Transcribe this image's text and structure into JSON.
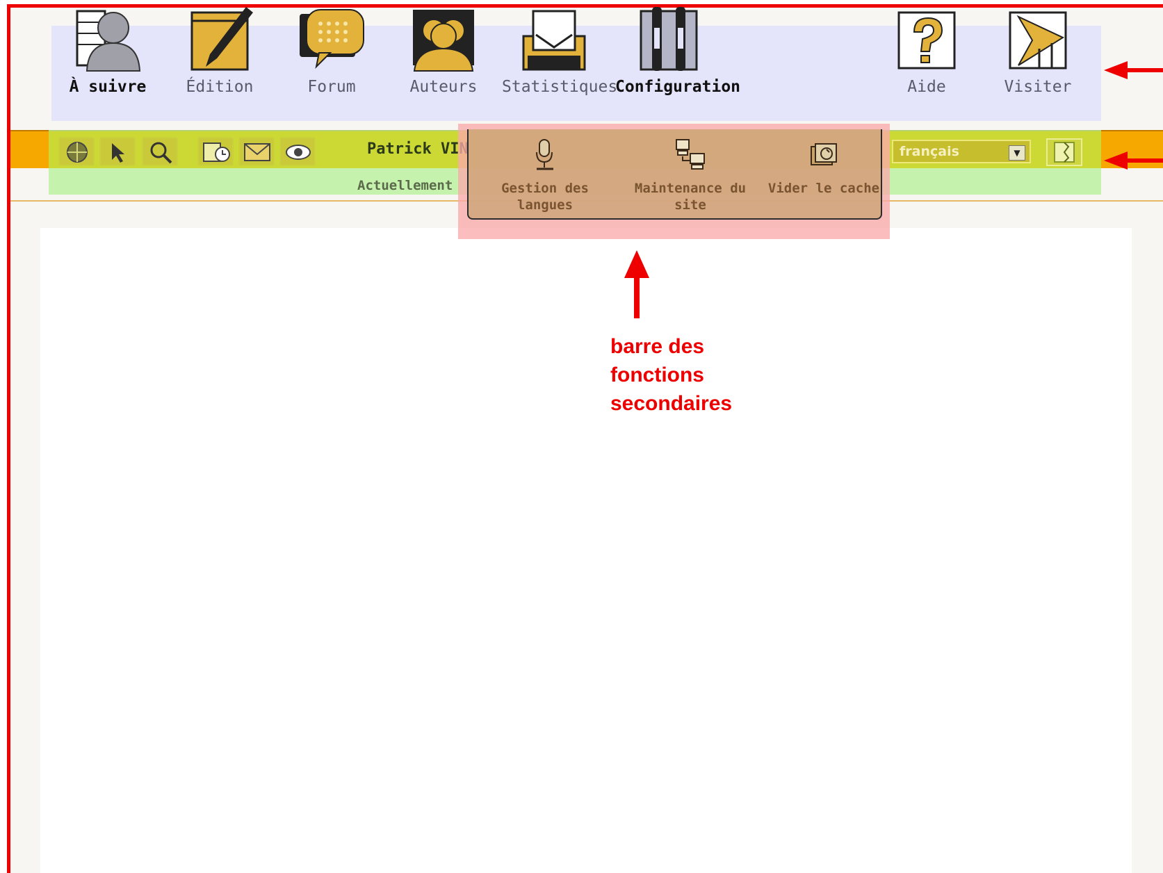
{
  "main_toolbar": {
    "items": [
      {
        "label": "À suivre",
        "icon": "user-follow-icon",
        "active": true
      },
      {
        "label": "Édition",
        "icon": "pen-edit-icon"
      },
      {
        "label": "Forum",
        "icon": "speech-bubble-icon"
      },
      {
        "label": "Auteurs",
        "icon": "authors-group-icon"
      },
      {
        "label": "Statistiques",
        "icon": "statistics-icon"
      },
      {
        "label": "Configuration",
        "icon": "tools-config-icon"
      },
      {
        "label": "Aide",
        "icon": "help-icon"
      },
      {
        "label": "Visiter",
        "icon": "visit-site-icon"
      }
    ]
  },
  "secondary_bar": {
    "user_name": "Patrick VIN",
    "status_text": "Actuellement",
    "language_value": "français",
    "mini_icons": [
      "globe-icon",
      "cursor-icon",
      "search-zoom-icon",
      "calendar-clock-icon",
      "mail-icon",
      "eye-icon"
    ]
  },
  "sub_menu": {
    "items": [
      {
        "label_line1": "Gestion des",
        "label_line2": "langues",
        "icon": "microphone-icon"
      },
      {
        "label_line1": "Maintenance du",
        "label_line2": "site",
        "icon": "computers-network-icon"
      },
      {
        "label_line1": "Vider le cache",
        "label_line2": "",
        "icon": "cache-folder-icon"
      }
    ]
  },
  "annotation": {
    "line1": "barre des",
    "line2": "fonctions",
    "line3": "secondaires",
    "color": "#ee0000"
  }
}
